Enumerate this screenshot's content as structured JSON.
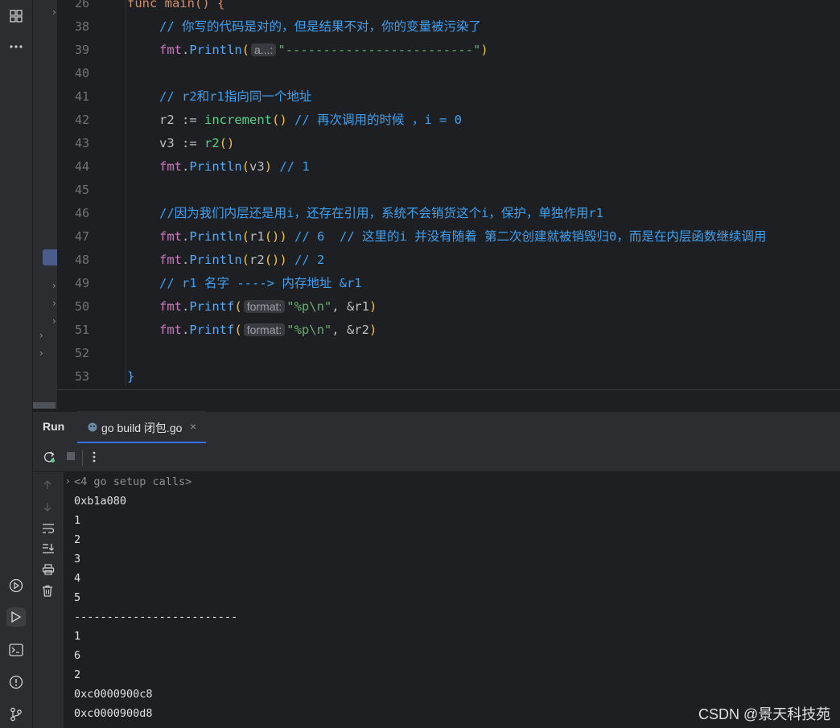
{
  "editor": {
    "peek_line": {
      "num": "26",
      "code": "func main() {"
    },
    "lines": [
      {
        "num": "38"
      },
      {
        "num": "39"
      },
      {
        "num": "40"
      },
      {
        "num": "41"
      },
      {
        "num": "42"
      },
      {
        "num": "43"
      },
      {
        "num": "44"
      },
      {
        "num": "45"
      },
      {
        "num": "46"
      },
      {
        "num": "47"
      },
      {
        "num": "48"
      },
      {
        "num": "49"
      },
      {
        "num": "50"
      },
      {
        "num": "51"
      },
      {
        "num": "52"
      },
      {
        "num": "53"
      }
    ],
    "code": {
      "l38_comment": "// 你写的代码是对的，但是结果不对，你的变量被污染了",
      "l39_pkg": "fmt",
      "l39_fn": "Println",
      "l39_hint": "a...:",
      "l39_str": "\"-------------------------\"",
      "l41_comment": "// r2和r1指向同一个地址",
      "l42_var": "r2 := ",
      "l42_call": "increment",
      "l42_comment": "// 再次调用的时候 ，i = 0",
      "l43_var": "v3 := ",
      "l43_call": "r2",
      "l44_pkg": "fmt",
      "l44_fn": "Println",
      "l44_arg": "v3",
      "l44_comment": "// 1",
      "l46_comment": "//因为我们内层还是用i，还存在引用，系统不会销货这个i，保护，单独作用r1",
      "l47_pkg": "fmt",
      "l47_fn": "Println",
      "l47_arg": "r1",
      "l47_comment": "// 6  // 这里的i 并没有随着 第二次创建就被销毁归0，而是在内层函数继续调用",
      "l48_pkg": "fmt",
      "l48_fn": "Println",
      "l48_arg": "r2",
      "l48_comment": "// 2",
      "l49_comment": "// r1 名字 ----> 内存地址 &r1",
      "l50_pkg": "fmt",
      "l50_fn": "Printf",
      "l50_hint": "format:",
      "l50_str": "\"%p\\n\"",
      "l50_arg": ", &r1",
      "l51_pkg": "fmt",
      "l51_fn": "Printf",
      "l51_hint": "format:",
      "l51_str": "\"%p\\n\"",
      "l51_arg": ", &r2",
      "l53_brace": "}"
    }
  },
  "run_panel": {
    "title": "Run",
    "tab_label": "go build 闭包.go",
    "tab_close": "×",
    "setup_calls": "<4 go setup calls>",
    "output": [
      "0xb1a080",
      "1",
      "2",
      "3",
      "4",
      "5",
      "-------------------------",
      "1",
      "6",
      "2",
      "0xc0000900c8",
      "0xc0000900d8"
    ]
  },
  "watermark": "CSDN @景天科技苑",
  "icons": {
    "left_strip": [
      "structure-icon",
      "more-icon",
      "services-icon",
      "run-icon",
      "terminal-icon",
      "problems-icon",
      "git-icon"
    ],
    "toolbar": [
      "rerun-icon",
      "stop-icon",
      "more-vertical-icon"
    ],
    "console_side": [
      "up-arrow-icon",
      "down-arrow-icon",
      "soft-wrap-icon",
      "scroll-to-end-icon",
      "print-icon",
      "trash-icon"
    ]
  },
  "colors": {
    "accent": "#3574f0",
    "comment": "#3ea0f0",
    "function": "#57aaf7",
    "package": "#c77dbb"
  }
}
